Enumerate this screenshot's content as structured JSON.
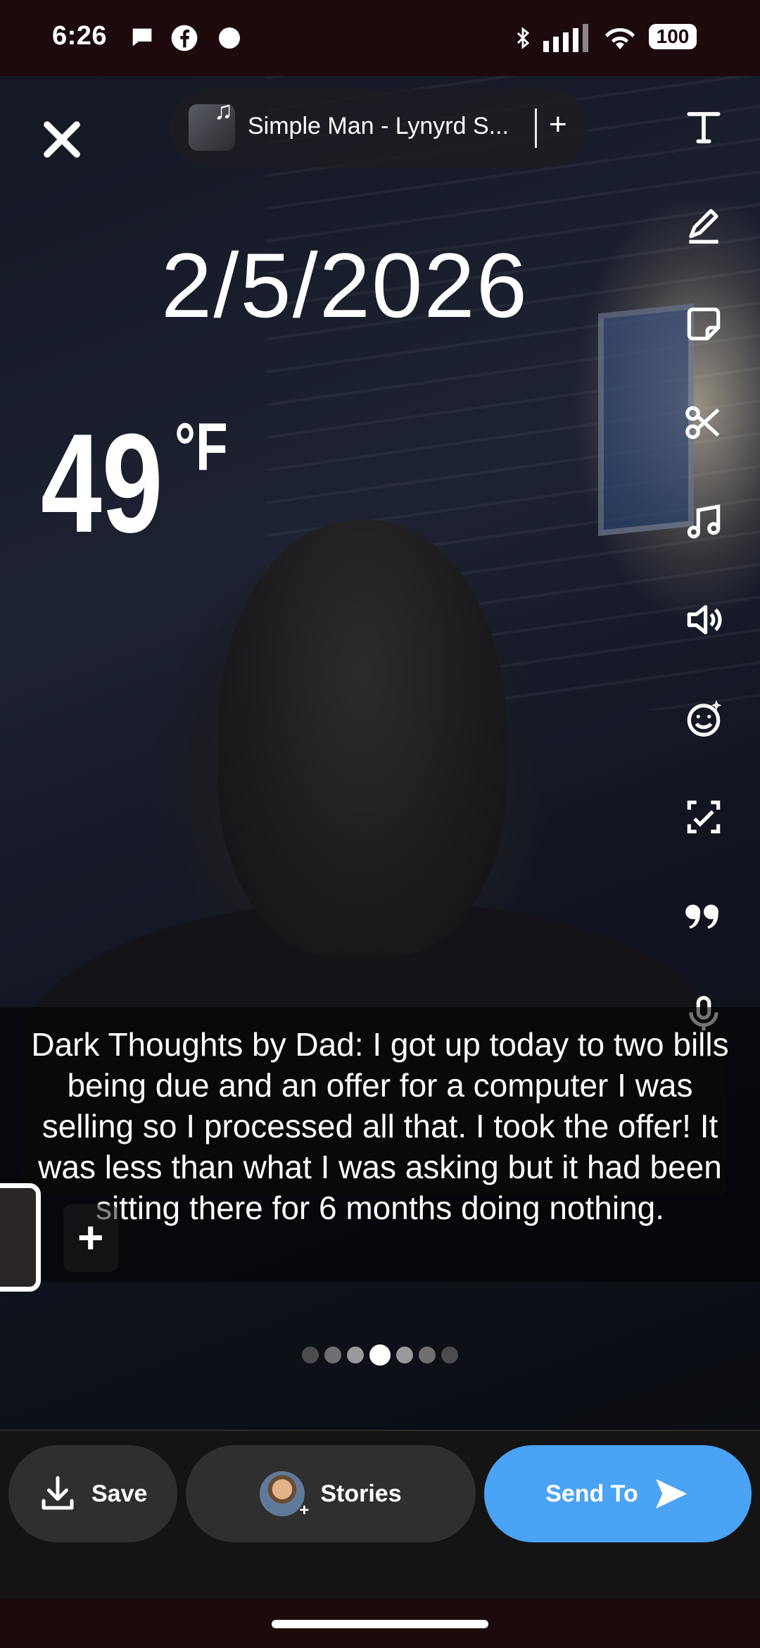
{
  "status_bar": {
    "time": "6:26",
    "battery": "100"
  },
  "music": {
    "title": "Simple Man - Lynyrd S...",
    "add_symbol": "+"
  },
  "stickers": {
    "date": "2/5/2026",
    "temperature_value": "49",
    "temperature_unit": "°F"
  },
  "toolbar_icons": [
    "text-icon",
    "pen-icon",
    "sticker-icon",
    "scissors-icon",
    "music-note-icon",
    "speaker-icon",
    "face-effects-icon",
    "scan-icon",
    "quote-icon",
    "microphone-icon"
  ],
  "caption": {
    "text": "Dark Thoughts by Dad: I got up today to two bills being due and an offer for a computer I was selling so I processed all that. I took the offer!  It was less than what I was asking but it had been sitting there for 6 months doing nothing."
  },
  "pager": {
    "count": 7,
    "active_index": 3
  },
  "actions": {
    "save_label": "Save",
    "stories_label": "Stories",
    "send_label": "Send To"
  },
  "colors": {
    "send_button": "#4aa3f5",
    "pill_background": "#2f2f2f"
  }
}
